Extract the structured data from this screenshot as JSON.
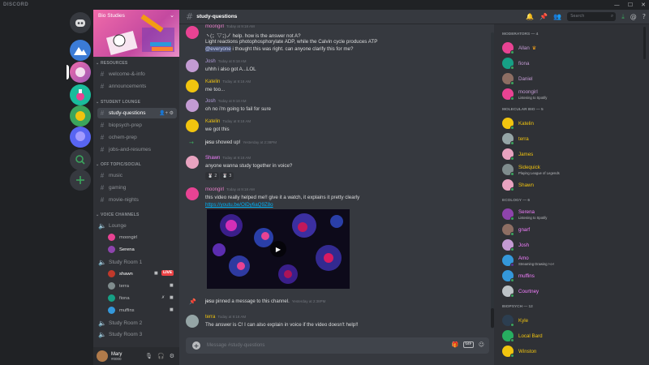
{
  "app": {
    "brand": "DISCORD"
  },
  "server": {
    "name": "Bio Studies"
  },
  "categories": {
    "resources": "RESOURCES",
    "student_lounge": "STUDENT LOUNGE",
    "off_topic": "OFF TOPIC/SOCIAL",
    "voice": "VOICE CHANNELS"
  },
  "channels": {
    "welcome": "welcome-&-info",
    "announcements": "announcements",
    "study_questions": "study-questions",
    "biopsych": "biopsych-prep",
    "ochem": "ochem-prep",
    "jobs": "jobs-and-resumes",
    "music": "music",
    "gaming": "gaming",
    "movie": "movie-nights"
  },
  "voice": {
    "lounge": "Lounge",
    "lounge_users": [
      "moongirl",
      "Serena"
    ],
    "room1": "Study Room 1",
    "room1_users": [
      "shawn",
      "terra",
      "fiona",
      "muffins"
    ],
    "live_badge": "LIVE",
    "room2": "Study Room 2",
    "room3": "Study Room 3"
  },
  "user_panel": {
    "name": "Mary",
    "tag": "#0000"
  },
  "topbar": {
    "channel": "study-questions",
    "search_placeholder": "Search"
  },
  "messages": {
    "m0": {
      "author": "moongirl",
      "time": "Today at 9:18 AM",
      "line1": "ヽ(；▽；)ノ help. how is the answer not A?",
      "line2": "Light reactions photophosphorylate ADP, while the Calvin cycle produces ATP",
      "mention": "@everyone",
      "line3": " i thought this was right. can anyone clarify this for me?"
    },
    "m1": {
      "author": "Josh",
      "time": "Today at 9:18 AM",
      "text": "uhhh i also got A...LOL"
    },
    "m2": {
      "author": "Katelin",
      "time": "Today at 9:18 AM",
      "text": "me too..."
    },
    "m3": {
      "author": "Josh",
      "time": "Today at 9:18 AM",
      "text": "oh no i'm going to fail for sure"
    },
    "m4": {
      "author": "Katelin",
      "time": "Today at 9:18 AM",
      "text": "we got this"
    },
    "join": {
      "user": "jesu",
      "text": " showed up!",
      "time": "Yesterday at 2:38PM"
    },
    "m5": {
      "author": "Shawn",
      "time": "Today at 9:18 AM",
      "text": "anyone wanna study together in voice?",
      "r1": "2",
      "r2": "3"
    },
    "m6": {
      "author": "moongirl",
      "time": "Today at 9:18 AM",
      "text": "this video really helped me!! give it a watch, it explains it pretty clearly",
      "link": "https://youtu.be/OiDy6aQ9Z8o"
    },
    "pin": {
      "user": "jesu",
      "text": " pinned a message to this channel.",
      "time": "Yesterday at 2:38PM"
    },
    "m7": {
      "author": "terra",
      "time": "Today at 9:18 AM",
      "text": "The answer is C! I can also explain in voice if the video doesn't help!!"
    }
  },
  "composer": {
    "placeholder": "Message #study-questions",
    "gif": "GIF"
  },
  "members": {
    "moderators": "MODERATORS — 4",
    "mod_list": [
      "Allan",
      "fiona",
      "Daniel",
      "moongirl"
    ],
    "moongirl_activity": "Listening to Spotify",
    "molecular": "MOLECULAR BIO — 5",
    "mol_list": [
      "Katelin",
      "terra",
      "James",
      "Sidequick",
      "Shawn"
    ],
    "sidequick_activity": "Playing League of Legends",
    "ecology": "ECOLOGY — 6",
    "eco_list": [
      "Serena",
      "gnarf",
      "Josh",
      "Amo",
      "muffins",
      "Courtney"
    ],
    "serena_activity": "Listening to Spotify",
    "amo_activity": "Streaming Drawing !-o-!",
    "biopsych": "BIOPSYCH — 12",
    "bio_list": [
      "Kyle",
      "Local Bard",
      "Winston"
    ]
  },
  "colors": {
    "accent": "#7289da",
    "online": "#3ba55d",
    "live": "#ed4245",
    "link": "#00b0f4"
  }
}
